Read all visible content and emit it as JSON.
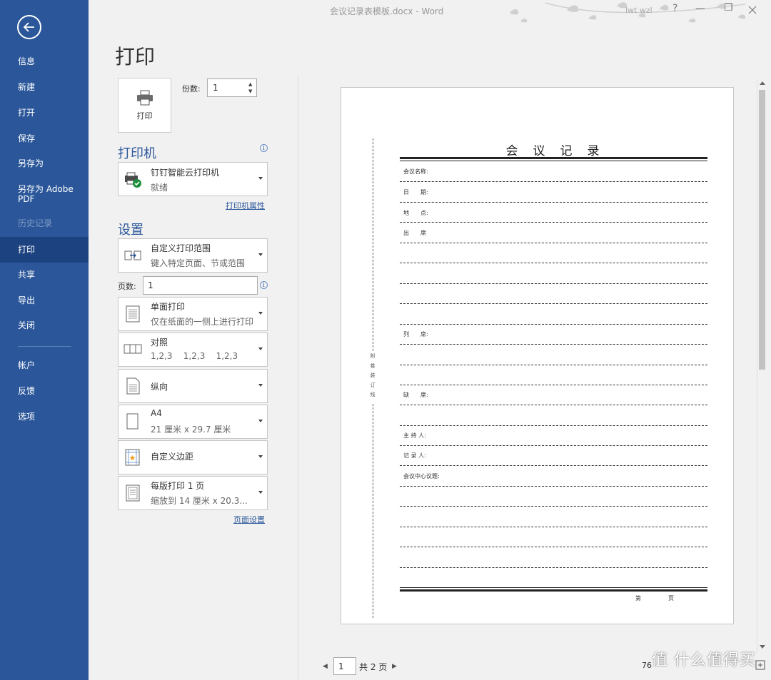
{
  "titlebar": {
    "document_title": "会议记录表模板.docx  -  Word",
    "user": "lwt wzl",
    "help": "?",
    "minimize": "—",
    "restore": "❐"
  },
  "sidebar": {
    "items": [
      {
        "label": "信息"
      },
      {
        "label": "新建"
      },
      {
        "label": "打开"
      },
      {
        "label": "保存"
      },
      {
        "label": "另存为"
      },
      {
        "label": "另存为 Adobe PDF"
      },
      {
        "label": "历史记录"
      },
      {
        "label": "打印"
      },
      {
        "label": "共享"
      },
      {
        "label": "导出"
      },
      {
        "label": "关闭"
      },
      {
        "label": "帐户"
      },
      {
        "label": "反馈"
      },
      {
        "label": "选项"
      }
    ]
  },
  "print": {
    "title": "打印",
    "button_label": "打印",
    "copies_label": "份数:",
    "copies_value": "1"
  },
  "printer": {
    "section_title": "打印机",
    "name": "钉钉智能云打印机",
    "status": "就绪",
    "properties_link": "打印机属性"
  },
  "settings": {
    "section_title": "设置",
    "range": {
      "title": "自定义打印范围",
      "subtitle": "键入特定页面、节或范围"
    },
    "pages_label": "页数:",
    "pages_value": "1",
    "sides": {
      "title": "单面打印",
      "subtitle": "仅在纸面的一侧上进行打印"
    },
    "collate": {
      "title": "对照",
      "subtitle": "1,2,3    1,2,3    1,2,3"
    },
    "orientation": {
      "title": "纵向"
    },
    "paper": {
      "title": "A4",
      "subtitle": "21 厘米 x 29.7 厘米"
    },
    "margins": {
      "title": "自定义边距"
    },
    "per_sheet": {
      "title": "每版打印 1 页",
      "subtitle": "缩放到 14 厘米 x 20.3..."
    },
    "page_setup_link": "页面设置"
  },
  "document": {
    "title": "会　议　记　录",
    "fields": {
      "name": "会议名称:",
      "date": "日　　期:",
      "place": "地　　点:",
      "attendees": "出　　席",
      "absent": "列　　席:",
      "missing": "缺　　席:",
      "host": "主 持 人:",
      "recorder": "记 录 人:",
      "topic": "会议中心议题:"
    },
    "binding_text": "附卷装订线",
    "footer_page": "第",
    "footer_page2": "页"
  },
  "bottom": {
    "page_current": "1",
    "page_total": "共 2 页",
    "zoom": "76"
  },
  "watermark": "值 什么值得买"
}
